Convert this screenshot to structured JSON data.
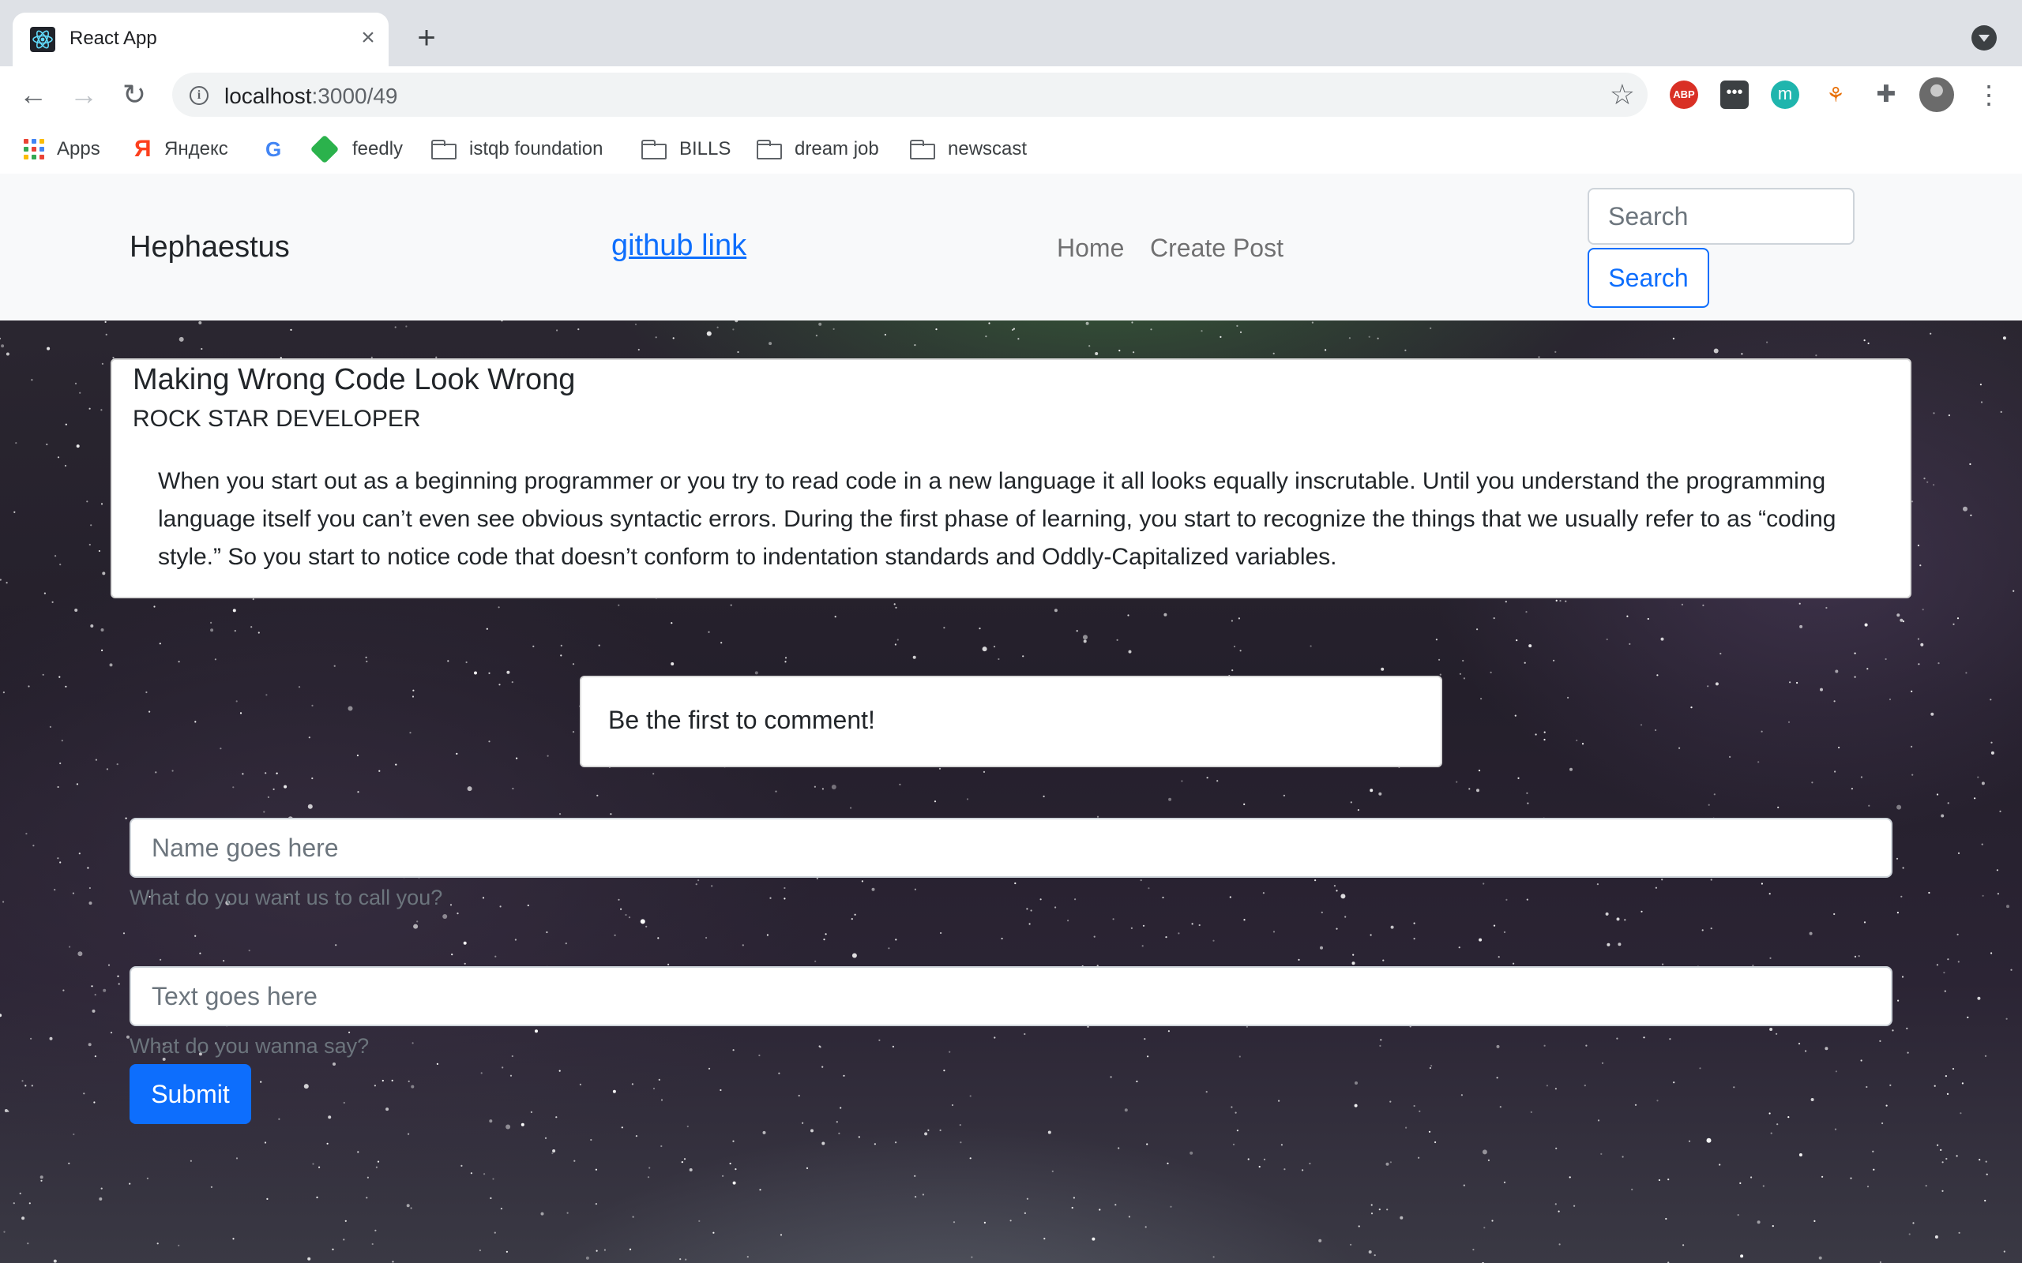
{
  "browser": {
    "tab_title": "React App",
    "url_host": "localhost",
    "url_path": ":3000/49",
    "extensions": [
      "adblock-plus-icon",
      "bitwarden-icon",
      "mercury-icon",
      "sitemap-icon",
      "extensions-puzzle-icon"
    ],
    "abp_label": "ABP",
    "m_label": "m",
    "bookmarks": [
      {
        "label": "Apps",
        "icon": "apps-grid-icon"
      },
      {
        "label": "Яндекс",
        "icon": "yandex-icon"
      },
      {
        "label": "",
        "icon": "google-icon"
      },
      {
        "label": "feedly",
        "icon": "feedly-icon"
      },
      {
        "label": "istqb foundation",
        "icon": "folder-icon"
      },
      {
        "label": "BILLS",
        "icon": "folder-icon"
      },
      {
        "label": "dream job",
        "icon": "folder-icon"
      },
      {
        "label": "newscast",
        "icon": "folder-icon"
      }
    ]
  },
  "navbar": {
    "brand": "Hephaestus",
    "github_link": "github link",
    "links": [
      "Home",
      "Create Post"
    ],
    "search_placeholder": "Search",
    "search_button": "Search"
  },
  "post": {
    "title": "Making Wrong Code Look Wrong",
    "author": "ROCK STAR DEVELOPER",
    "body": "When you start out as a beginning programmer or you try to read code in a new language it all looks equally inscrutable. Until you understand the programming language itself you can’t even see obvious syntactic errors. During the first phase of learning, you start to recognize the things that we usually refer to as “coding style.” So you start to notice code that doesn’t conform to indentation standards and Oddly-Capitalized variables."
  },
  "comments": {
    "empty_message": "Be the first to comment!"
  },
  "comment_form": {
    "name_placeholder": "Name goes here",
    "name_help": "What do you want us to call you?",
    "text_placeholder": "Text goes here",
    "text_help": "What do you wanna say?",
    "submit_label": "Submit"
  },
  "colors": {
    "primary": "#0d6efd",
    "navbar_bg": "#f8f9fa",
    "text": "#212529",
    "muted": "#6c757d"
  }
}
